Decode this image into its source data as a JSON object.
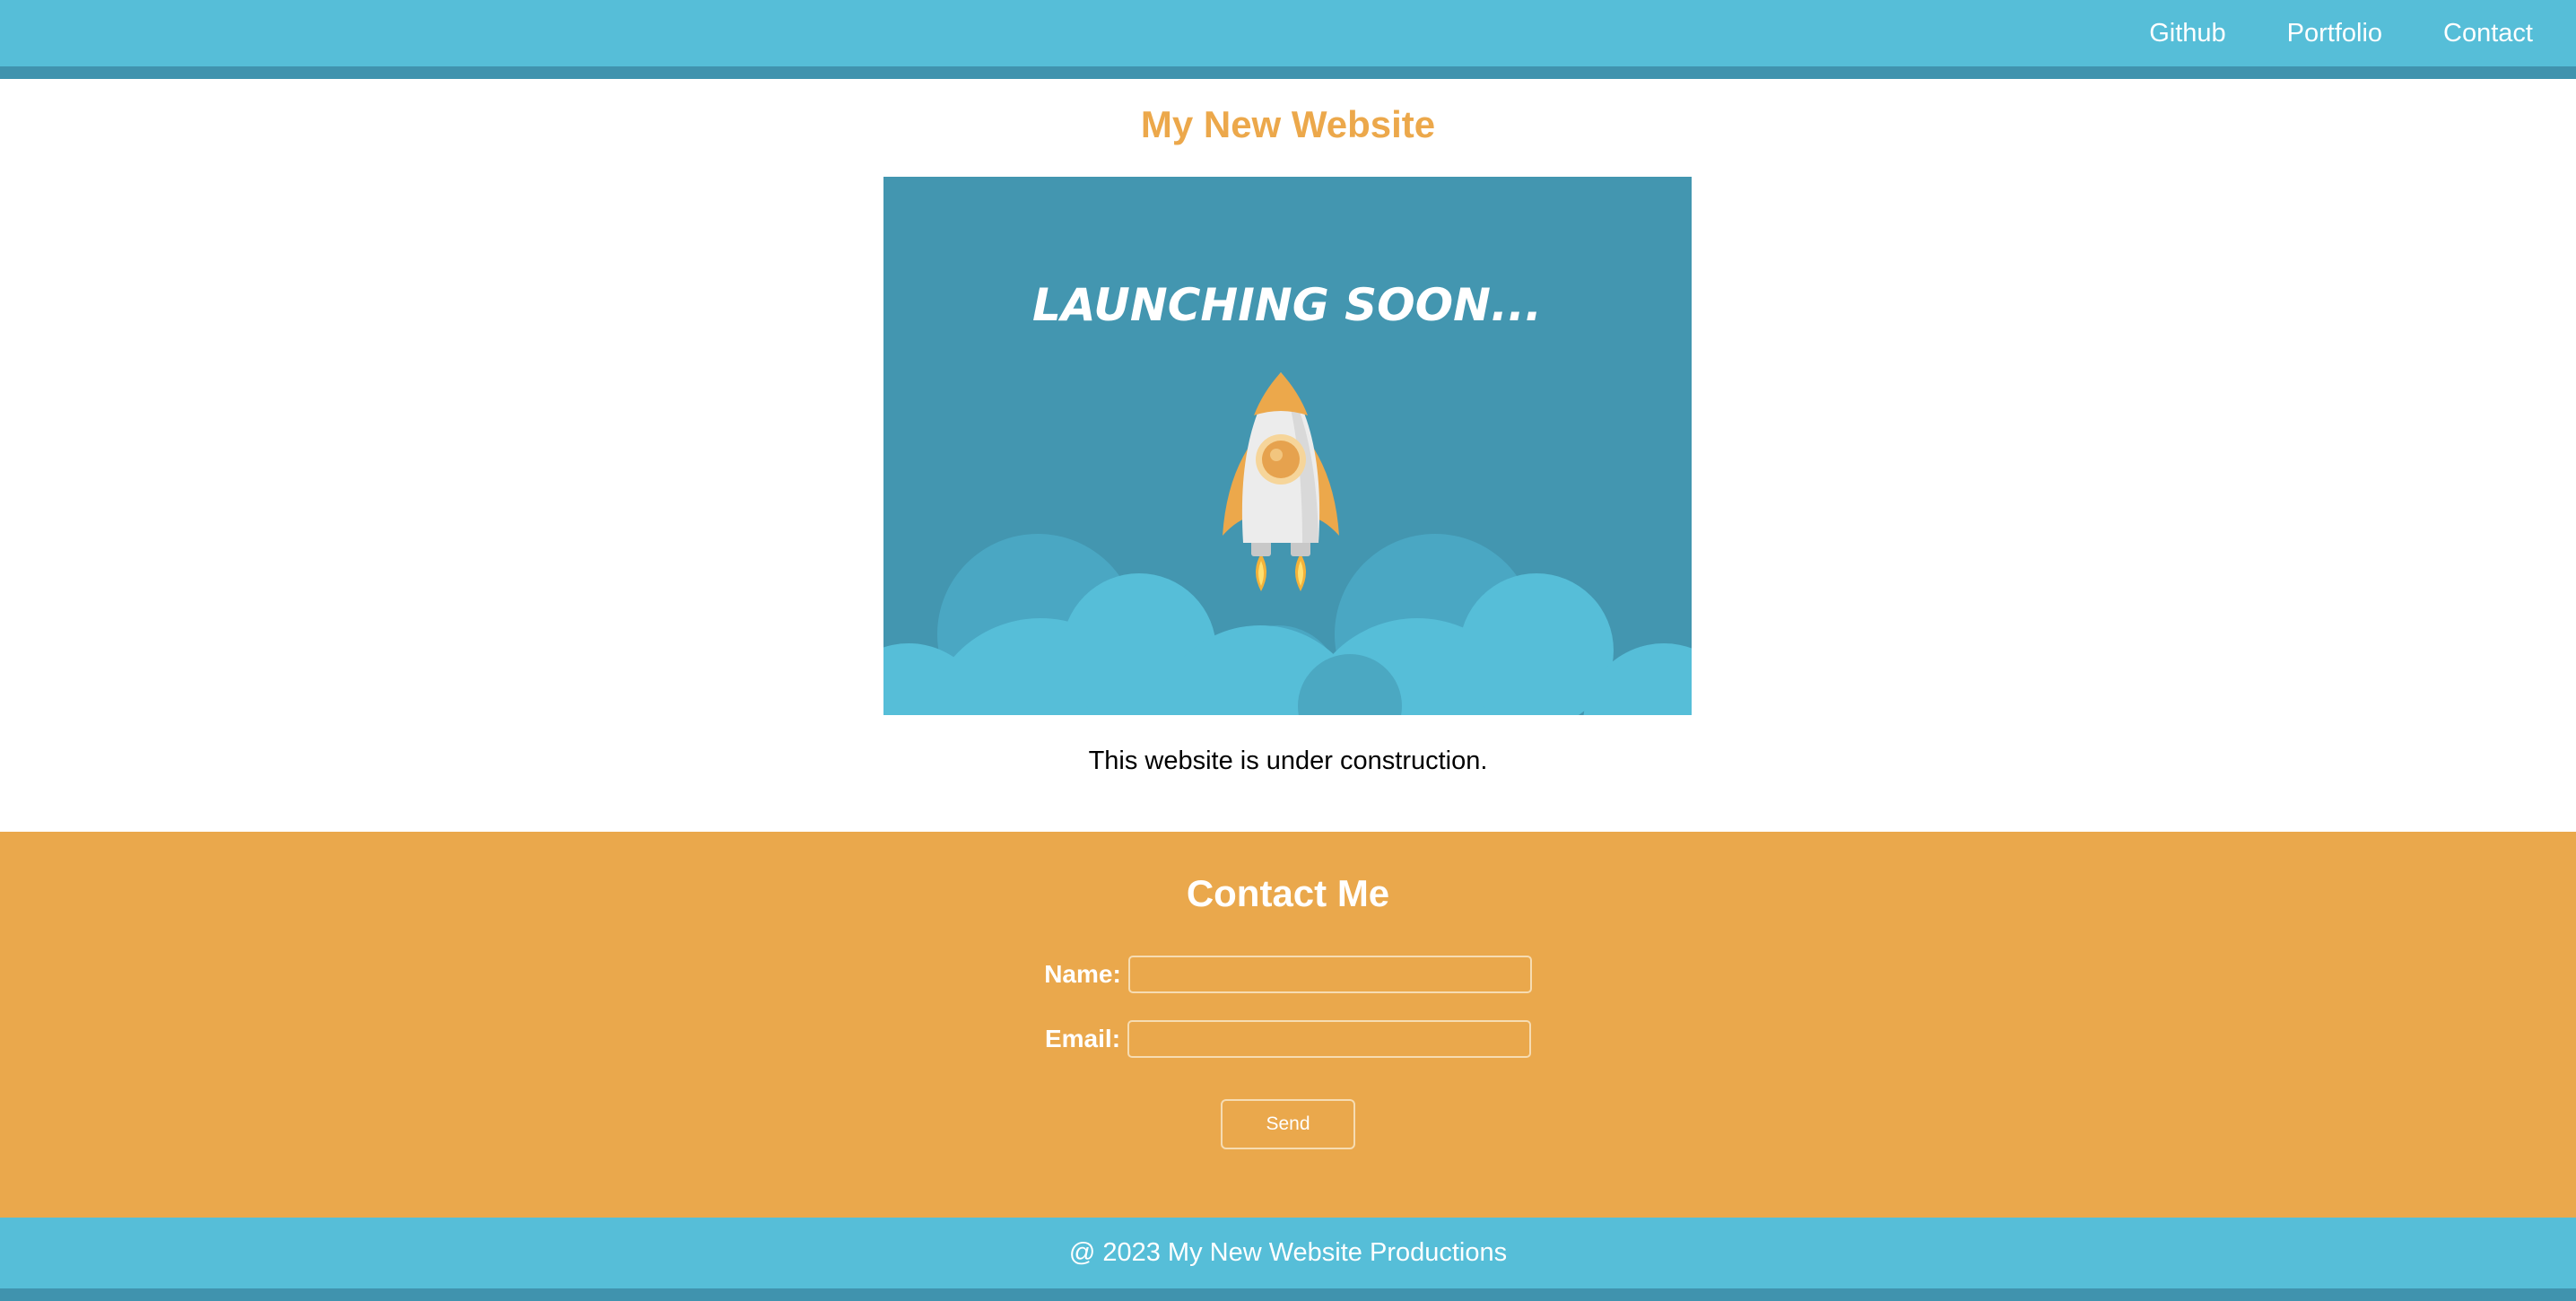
{
  "nav": {
    "items": [
      {
        "label": "Github"
      },
      {
        "label": "Portfolio"
      },
      {
        "label": "Contact"
      }
    ]
  },
  "main": {
    "title": "My New Website",
    "hero_text": "LAUNCHING SOON...",
    "construction_text": "This website is under construction."
  },
  "contact": {
    "heading": "Contact Me",
    "name_label": "Name:",
    "name_value": "",
    "email_label": "Email:",
    "email_value": "",
    "send_label": "Send"
  },
  "footer": {
    "text": "@ 2023 My New Website Productions"
  },
  "colors": {
    "primary_blue": "#56bed8",
    "dark_blue": "#4093ae",
    "orange": "#eaa84c",
    "title_orange": "#eca84b"
  },
  "icons": {
    "hero_graphic": "rocket-icon"
  }
}
